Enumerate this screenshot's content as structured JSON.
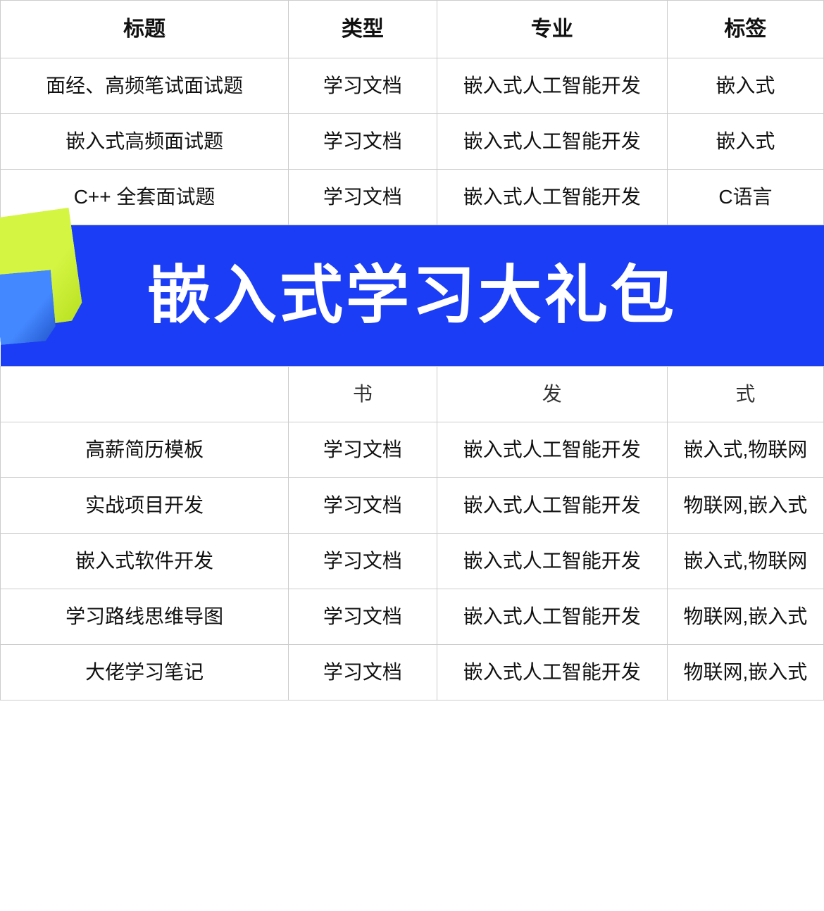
{
  "table": {
    "headers": [
      "标题",
      "类型",
      "专业",
      "标签"
    ],
    "rows": [
      {
        "title": "面经、高频笔试面试题",
        "type": "学习文档",
        "major": "嵌入式人工智能开发",
        "tag": "嵌入式"
      },
      {
        "title": "嵌入式高频面试题",
        "type": "学习文档",
        "major": "嵌入式人工智能开发",
        "tag": "嵌入式"
      },
      {
        "title": "C++ 全套面试题",
        "type": "学习文档",
        "major": "嵌入式人工智能开发",
        "tag": "C语言"
      }
    ],
    "partial_row": {
      "col2": "书",
      "col3": "发",
      "col4": "式"
    },
    "rows_after_banner": [
      {
        "title": "高薪简历模板",
        "type": "学习文档",
        "major": "嵌入式人工智能开发",
        "tag": "嵌入式,物联网"
      },
      {
        "title": "实战项目开发",
        "type": "学习文档",
        "major": "嵌入式人工智能开发",
        "tag": "物联网,嵌入式"
      },
      {
        "title": "嵌入式软件开发",
        "type": "学习文档",
        "major": "嵌入式人工智能开发",
        "tag": "嵌入式,物联网"
      },
      {
        "title": "学习路线思维导图",
        "type": "学习文档",
        "major": "嵌入式人工智能开发",
        "tag": "物联网,嵌入式"
      },
      {
        "title": "大佬学习笔记",
        "type": "学习文档",
        "major": "嵌入式人工智能开发",
        "tag": "物联网,嵌入式"
      }
    ],
    "banner_text": "嵌入式学习大礼包",
    "colors": {
      "banner_bg": "#1a3df5",
      "banner_text": "#ffffff",
      "sticky_green": "#d4f542",
      "sticky_blue": "#4488ff"
    }
  }
}
